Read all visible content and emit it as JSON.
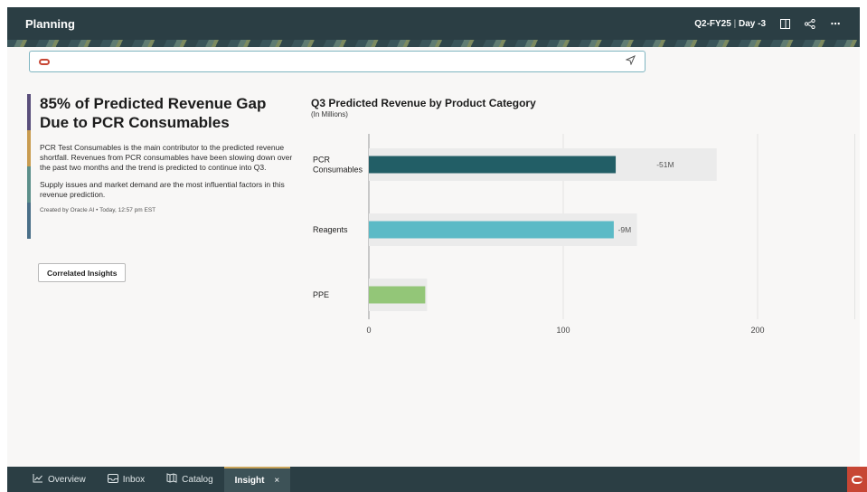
{
  "header": {
    "title": "Planning",
    "period": "Q2-FY25",
    "day": "Day -3",
    "icons": [
      "panel-icon",
      "share-icon",
      "more-icon"
    ]
  },
  "ask": {
    "value": "",
    "placeholder": ""
  },
  "insight": {
    "title": "85% of Predicted Revenue Gap Due to PCR Consumables",
    "paragraph1": "PCR Test Consumables is the main contributor to the predicted revenue shortfall. Revenues from PCR consumables have been slowing down over the past two months and the trend is predicted to continue into Q3.",
    "paragraph2": "Supply issues and market demand are the most influential factors in this revenue prediction.",
    "meta": "Created by Oracle AI  •  Today, 12:57 pm EST",
    "button": "Correlated Insights"
  },
  "chart_title": "Q3 Predicted Revenue by Product Category",
  "chart_subtitle": "(In Millions)",
  "chart_data": {
    "type": "bar",
    "orientation": "horizontal",
    "categories": [
      "PCR Consumables",
      "Reagents",
      "PPE"
    ],
    "category_labels": [
      [
        "PCR",
        "Consumables"
      ],
      [
        "Reagents"
      ],
      [
        "PPE"
      ]
    ],
    "series": [
      {
        "values": [
          127,
          126,
          29
        ],
        "colors": [
          "#225e66",
          "#5bbac6",
          "#93c678"
        ]
      }
    ],
    "targets": [
      178,
      137,
      29
    ],
    "gap_labels": [
      "-51M",
      "-9M",
      ""
    ],
    "xticks": [
      0,
      100,
      200
    ],
    "xlim": [
      0,
      250
    ],
    "grid": true
  },
  "tabs": [
    {
      "icon": "chart-icon",
      "label": "Overview"
    },
    {
      "icon": "inbox-icon",
      "label": "Inbox"
    },
    {
      "icon": "catalog-icon",
      "label": "Catalog"
    },
    {
      "icon": "",
      "label": "Insight",
      "close": "×"
    }
  ],
  "glyphs": {
    "send": "◁",
    "more": "⋯",
    "overview": "⟋",
    "inbox": "▭",
    "catalog": "▥"
  }
}
